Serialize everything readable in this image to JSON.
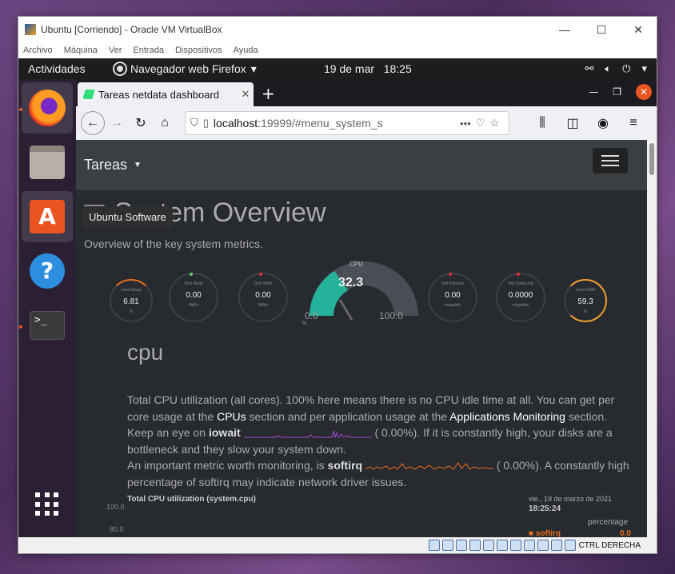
{
  "vbox": {
    "title": "Ubuntu [Corriendo] - Oracle VM VirtualBox",
    "menu": [
      "Archivo",
      "Máquina",
      "Ver",
      "Entrada",
      "Dispositivos",
      "Ayuda"
    ],
    "host_key": "CTRL DERECHA"
  },
  "gnome": {
    "activities": "Actividades",
    "app_name": "Navegador web Firefox",
    "date": "19 de mar",
    "time": "18:25",
    "tooltip": "Ubuntu Software"
  },
  "firefox": {
    "tab_title": "Tareas netdata dashboard",
    "url_host": "localhost",
    "url_rest": ":19999/#menu_system_s"
  },
  "netdata": {
    "brand": "Tareas",
    "title": "System Overview",
    "subtitle": "Overview of the key system metrics.",
    "gauges": {
      "swap": {
        "title": "Used Swap",
        "value": "6.81",
        "unit": "%"
      },
      "disk_read": {
        "title": "Disk Read",
        "value": "0.00",
        "unit": "MiB/s"
      },
      "disk_write": {
        "title": "Disk Write",
        "value": "0.00",
        "unit": "MiB/s"
      },
      "cpu": {
        "title": "CPU",
        "value": "32.3",
        "min": "0.0",
        "max": "100.0",
        "unit": "%"
      },
      "net_in": {
        "title": "Net Inbound",
        "value": "0.00",
        "unit": "megabits"
      },
      "net_out": {
        "title": "Net Outbound",
        "value": "0.0000",
        "unit": "megabits"
      },
      "ram": {
        "title": "Used RAM",
        "value": "59.3",
        "unit": "%"
      }
    },
    "section": "cpu",
    "desc1_a": "Total CPU utilization (all cores). 100% here means there is no CPU idle time at all. You can get per core usage at the ",
    "desc1_link1": "CPUs",
    "desc1_b": " section and per application usage at the ",
    "desc1_link2": "Applications Monitoring",
    "desc1_c": " section.",
    "desc2_a": "Keep an eye on ",
    "desc2_b": "iowait",
    "desc2_c": " (      0.00%). If it is constantly high, your disks are a bottleneck and they slow your system down.",
    "desc3_a": "An important metric worth monitoring, is ",
    "desc3_b": "softirq",
    "desc3_c": " (      0.00%). A constantly high percentage of softirq may indicate network driver issues.",
    "chart_title": "Total CPU utilization (system.cpu)",
    "chart_date": "vie., 19 de marzo de 2021",
    "chart_time": "18:25:24",
    "chart_unit": "percentage",
    "chart_series": "softirq",
    "chart_series_value": "0.0",
    "y_ticks": [
      "100.0",
      "80.0"
    ]
  }
}
